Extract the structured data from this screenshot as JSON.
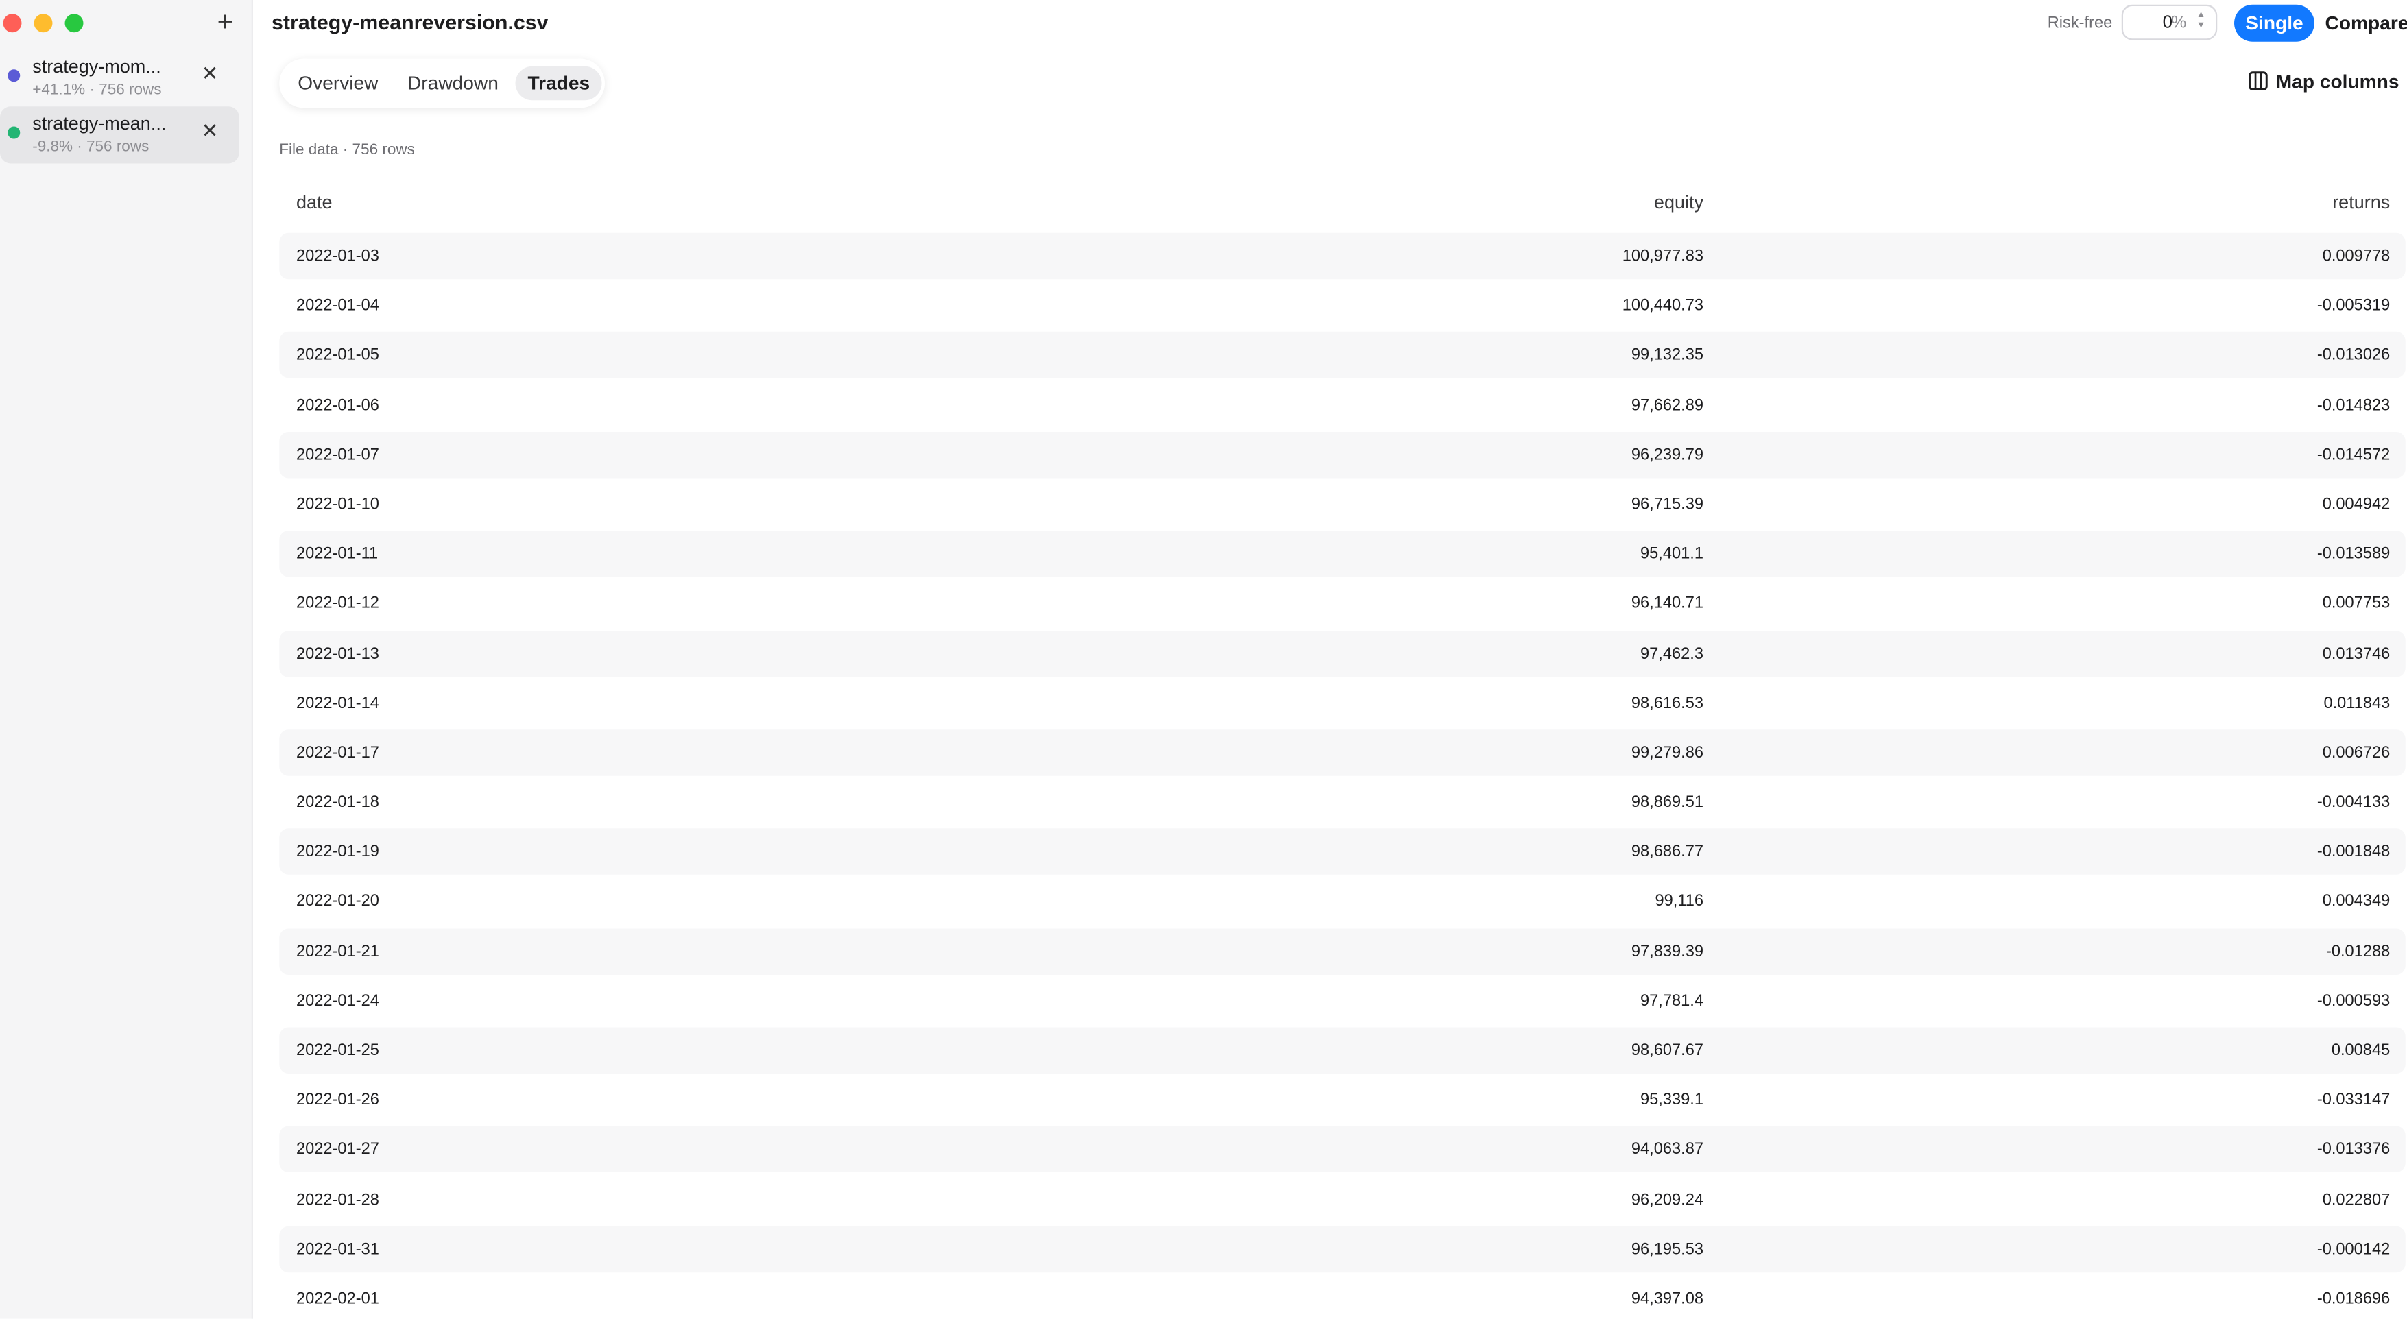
{
  "sidebar": {
    "add_label": "+",
    "files": [
      {
        "name": "strategy-mom...",
        "meta": "+41.1% · 756 rows",
        "color": "#5b5bd6",
        "active": false
      },
      {
        "name": "strategy-mean...",
        "meta": "-9.8% · 756 rows",
        "color": "#22b573",
        "active": true
      }
    ]
  },
  "header": {
    "title": "strategy-meanreversion.csv",
    "risk_free_label": "Risk-free",
    "risk_free_value": "0",
    "risk_free_unit": "%",
    "mode_single": "Single",
    "mode_compare": "Compare"
  },
  "tabs": [
    {
      "label": "Overview",
      "active": false
    },
    {
      "label": "Drawdown",
      "active": false
    },
    {
      "label": "Trades",
      "active": true
    }
  ],
  "map_columns_label": "Map columns",
  "section_label": "File data · 756 rows",
  "table": {
    "columns": [
      "date",
      "equity",
      "returns"
    ],
    "rows": [
      [
        "2022-01-03",
        "100,977.83",
        "0.009778"
      ],
      [
        "2022-01-04",
        "100,440.73",
        "-0.005319"
      ],
      [
        "2022-01-05",
        "99,132.35",
        "-0.013026"
      ],
      [
        "2022-01-06",
        "97,662.89",
        "-0.014823"
      ],
      [
        "2022-01-07",
        "96,239.79",
        "-0.014572"
      ],
      [
        "2022-01-10",
        "96,715.39",
        "0.004942"
      ],
      [
        "2022-01-11",
        "95,401.1",
        "-0.013589"
      ],
      [
        "2022-01-12",
        "96,140.71",
        "0.007753"
      ],
      [
        "2022-01-13",
        "97,462.3",
        "0.013746"
      ],
      [
        "2022-01-14",
        "98,616.53",
        "0.011843"
      ],
      [
        "2022-01-17",
        "99,279.86",
        "0.006726"
      ],
      [
        "2022-01-18",
        "98,869.51",
        "-0.004133"
      ],
      [
        "2022-01-19",
        "98,686.77",
        "-0.001848"
      ],
      [
        "2022-01-20",
        "99,116",
        "0.004349"
      ],
      [
        "2022-01-21",
        "97,839.39",
        "-0.01288"
      ],
      [
        "2022-01-24",
        "97,781.4",
        "-0.000593"
      ],
      [
        "2022-01-25",
        "98,607.67",
        "0.00845"
      ],
      [
        "2022-01-26",
        "95,339.1",
        "-0.033147"
      ],
      [
        "2022-01-27",
        "94,063.87",
        "-0.013376"
      ],
      [
        "2022-01-28",
        "96,209.24",
        "0.022807"
      ],
      [
        "2022-01-31",
        "96,195.53",
        "-0.000142"
      ],
      [
        "2022-02-01",
        "94,397.08",
        "-0.018696"
      ]
    ]
  }
}
